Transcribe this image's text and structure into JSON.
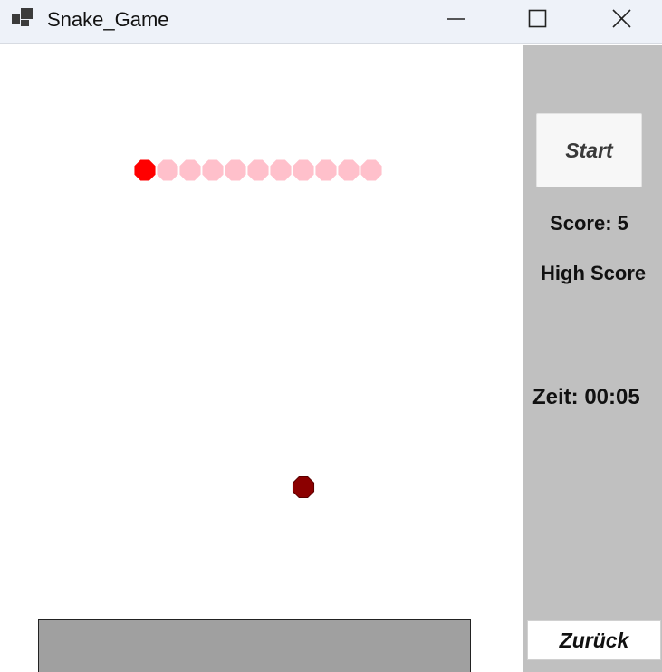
{
  "window": {
    "title": "Snake_Game",
    "app_icon": "window-stack-icon",
    "controls": {
      "minimize_icon": "minimize-icon",
      "maximize_icon": "maximize-icon",
      "close_icon": "close-icon"
    }
  },
  "sidebar": {
    "start_label": "Start",
    "score_text": "Score: 5",
    "highscore_text": "High Score",
    "time_text": "Zeit: 00:05",
    "back_label": "Zurück"
  },
  "game": {
    "snake": {
      "head_color": "#ff0000",
      "body_color": "#ffc0cb",
      "length": 11,
      "direction": "left"
    },
    "food": {
      "color": "#8b0000"
    },
    "panel_color": "#c0c0c0",
    "bottom_bar_color": "#a0a0a0"
  }
}
